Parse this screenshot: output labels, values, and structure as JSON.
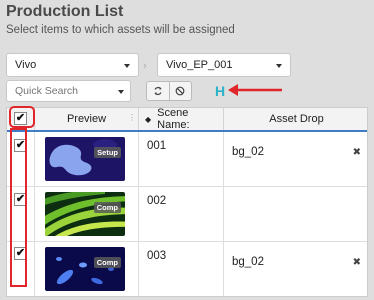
{
  "header": {
    "title": "Production List",
    "subtitle": "Select items to which assets will be assigned"
  },
  "filters": {
    "project": "Vivo",
    "episode": "Vivo_EP_001",
    "separator": "›",
    "search_placeholder": "Quick Search",
    "search_value": ""
  },
  "toolbar": {
    "refresh_icon": "refresh-icon",
    "clear_icon": "no-entry-icon",
    "h_label": "H",
    "colors": {
      "h_icon": "#2ab3c8",
      "annotation": "#e0262b"
    }
  },
  "table": {
    "columns": {
      "select_all_check": "✔",
      "preview": "Preview",
      "sort_glyph": "◆",
      "scene_name": "Scene Name:",
      "asset_drop": "Asset Drop",
      "col_menu": "⋮"
    },
    "rows": [
      {
        "checked": "✔",
        "badge": "Setup",
        "scene": "001",
        "asset": "bg_02",
        "remove": "✖"
      },
      {
        "checked": "✔",
        "badge": "Comp",
        "scene": "002",
        "asset": "",
        "remove": ""
      },
      {
        "checked": "✔",
        "badge": "Comp",
        "scene": "003",
        "asset": "bg_02",
        "remove": "✖"
      }
    ],
    "header_accent": "#3f7ec7"
  }
}
